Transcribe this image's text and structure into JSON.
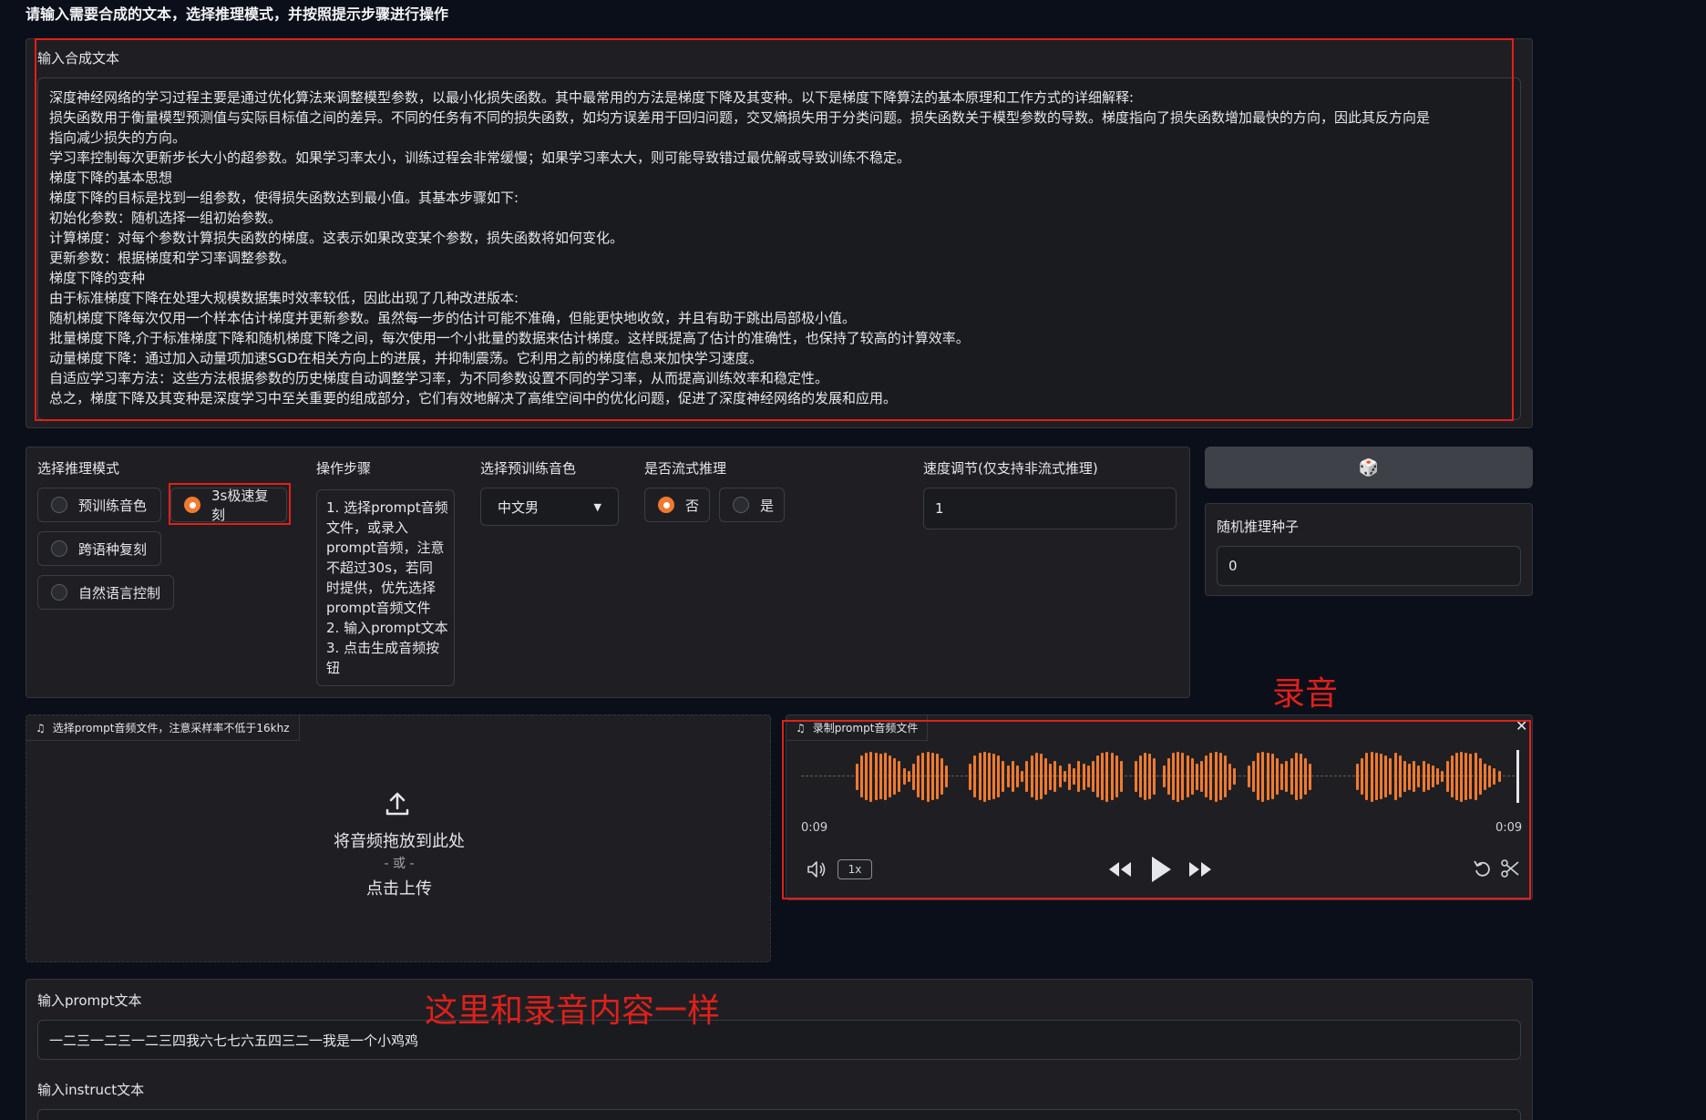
{
  "page": {
    "heading": "请输入需要合成的文本，选择推理模式，并按照提示步骤进行操作"
  },
  "tts_text": {
    "label": "输入合成文本",
    "lines": [
      "深度神经网络的学习过程主要是通过优化算法来调整模型参数，以最小化损失函数。其中最常用的方法是梯度下降及其变种。以下是梯度下降算法的基本原理和工作方式的详细解释:",
      "损失函数用于衡量模型预测值与实际目标值之间的差异。不同的任务有不同的损失函数，如均方误差用于回归问题，交叉熵损失用于分类问题。损失函数关于模型参数的导数。梯度指向了损失函数增加最快的方向，因此其反方向是",
      "指向减少损失的方向。",
      "学习率控制每次更新步长大小的超参数。如果学习率太小，训练过程会非常缓慢；如果学习率太大，则可能导致错过最优解或导致训练不稳定。",
      "梯度下降的基本思想",
      "梯度下降的目标是找到一组参数，使得损失函数达到最小值。其基本步骤如下:",
      "初始化参数：随机选择一组初始参数。",
      "计算梯度：对每个参数计算损失函数的梯度。这表示如果改变某个参数，损失函数将如何变化。",
      "更新参数：根据梯度和学习率调整参数。",
      "梯度下降的变种",
      "由于标准梯度下降在处理大规模数据集时效率较低，因此出现了几种改进版本:",
      "随机梯度下降每次仅用一个样本估计梯度并更新参数。虽然每一步的估计可能不准确，但能更快地收敛，并且有助于跳出局部极小值。",
      "批量梯度下降,介于标准梯度下降和随机梯度下降之间，每次使用一个小批量的数据来估计梯度。这样既提高了估计的准确性，也保持了较高的计算效率。",
      "动量梯度下降：通过加入动量项加速SGD在相关方向上的进展，并抑制震荡。它利用之前的梯度信息来加快学习速度。",
      "自适应学习率方法：这些方法根据参数的历史梯度自动调整学习率，为不同参数设置不同的学习率，从而提高训练效率和稳定性。",
      "总之，梯度下降及其变种是深度学习中至关重要的组成部分，它们有效地解决了高维空间中的优化问题，促进了深度神经网络的发展和应用。"
    ]
  },
  "mode": {
    "label": "选择推理模式",
    "options": [
      "预训练音色",
      "3s极速复刻",
      "跨语种复刻",
      "自然语言控制"
    ],
    "selected": "3s极速复刻"
  },
  "steps": {
    "label": "操作步骤",
    "lines": [
      "1. 选择prompt音频",
      "文件，或录入",
      "prompt音频，注意",
      "不超过30s，若同",
      "时提供，优先选择",
      "prompt音频文件",
      "2. 输入prompt文本",
      "3. 点击生成音频按",
      "钮"
    ]
  },
  "voice": {
    "label": "选择预训练音色",
    "value": "中文男"
  },
  "stream": {
    "label": "是否流式推理",
    "options": [
      "否",
      "是"
    ],
    "selected": "否"
  },
  "speed": {
    "label": "速度调节(仅支持非流式推理)",
    "value": "1"
  },
  "seed": {
    "dice": "🎲",
    "label": "随机推理种子",
    "value": "0"
  },
  "upload": {
    "tab_label": "选择prompt音频文件，注意采样率不低于16khz",
    "drop_text": "将音频拖放到此处",
    "or_text": "- 或 -",
    "click_text": "点击上传"
  },
  "record": {
    "tab_label": "录制prompt音频文件",
    "time_start": "0:09",
    "time_end": "0:09",
    "rate": "1x",
    "waveform_levels": [
      0.1,
      0.1,
      0.1,
      0.1,
      0.1,
      0.1,
      0.1,
      0.1,
      0.1,
      0.1,
      0.5,
      0.8,
      0.9,
      0.95,
      0.9,
      0.85,
      0.9,
      0.8,
      0.7,
      0.6,
      0.3,
      0.2,
      0.5,
      0.8,
      0.9,
      0.95,
      0.9,
      0.85,
      0.7,
      0.4,
      0.1,
      0.1,
      0.1,
      0.1,
      0.5,
      0.8,
      0.9,
      0.95,
      0.9,
      0.85,
      0.8,
      0.6,
      0.4,
      0.6,
      0.4,
      0.2,
      0.6,
      0.8,
      0.9,
      0.85,
      0.7,
      0.5,
      0.6,
      0.4,
      0.2,
      0.5,
      0.3,
      0.6,
      0.5,
      0.4,
      0.6,
      0.8,
      0.9,
      0.95,
      0.9,
      0.8,
      0.6,
      0.1,
      0.1,
      0.6,
      0.8,
      0.9,
      0.85,
      0.7,
      0.1,
      0.4,
      0.7,
      0.9,
      0.95,
      0.9,
      0.8,
      0.7,
      0.5,
      0.6,
      0.8,
      0.9,
      0.95,
      0.9,
      0.8,
      0.5,
      0.3,
      0.1,
      0.1,
      0.4,
      0.6,
      0.9,
      0.95,
      0.9,
      0.85,
      0.7,
      0.5,
      0.6,
      0.7,
      0.9,
      0.85,
      0.7,
      0.5,
      0.1,
      0.1,
      0.1,
      0.1,
      0.1,
      0.1,
      0.1,
      0.1,
      0.1,
      0.5,
      0.7,
      0.9,
      0.95,
      0.9,
      0.85,
      0.8,
      0.7,
      0.9,
      0.8,
      0.6,
      0.5,
      0.6,
      0.4,
      0.6,
      0.5,
      0.4,
      0.3,
      0.2,
      0.6,
      0.8,
      0.9,
      0.95,
      0.9,
      0.85,
      0.9,
      0.7,
      0.5,
      0.4,
      0.3,
      0.2,
      0.1,
      0.1
    ],
    "icons": [
      "volume-icon",
      "rewind-icon",
      "play-icon",
      "fast-forward-icon",
      "undo-icon",
      "scissors-icon"
    ]
  },
  "prompt_text": {
    "label": "输入prompt文本",
    "value": "一二三一二三一二三四我六七七六五四三二一我是一个小鸡鸡"
  },
  "instruct_text": {
    "label": "输入instruct文本"
  },
  "annotations": {
    "record": "录音",
    "prompt": "这里和录音内容一样"
  },
  "colors": {
    "accent": "#f07a2f",
    "annotation_red": "#e0201a",
    "background": "#0b0f19",
    "panel": "#1f1f23"
  }
}
